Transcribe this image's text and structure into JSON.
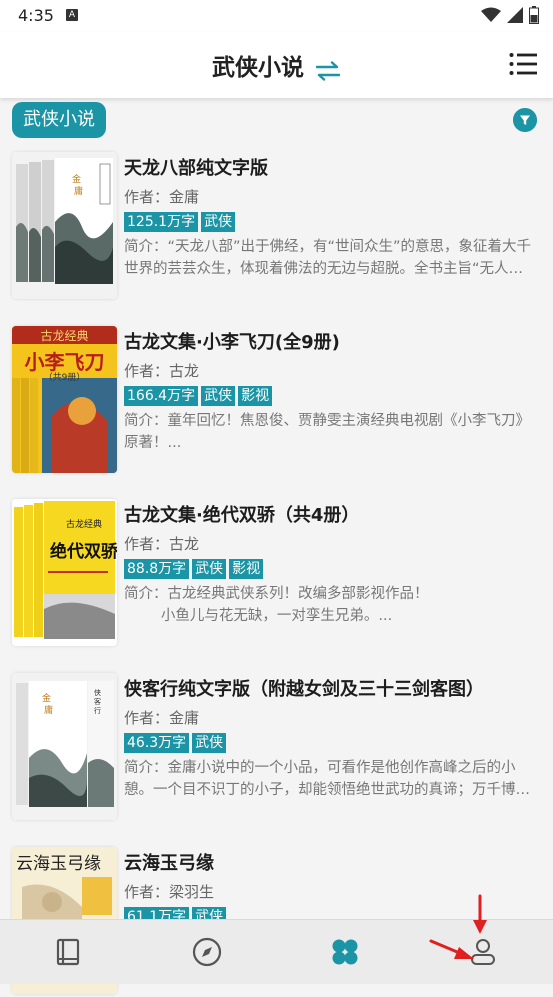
{
  "status": {
    "time": "4:35",
    "notif_letter": "A"
  },
  "header": {
    "title": "武侠小说",
    "swap_icon": "swap-arrows-icon",
    "menu_icon": "list-menu-icon"
  },
  "category_chip": "武侠小说",
  "filter_icon": "filter-icon",
  "colors": {
    "accent": "#1b95a6",
    "arrow": "#e02020"
  },
  "books": [
    {
      "title": "天龙八部纯文字版",
      "author": "作者：金庸",
      "tags": [
        "125.1万字",
        "武侠"
      ],
      "intro": "简介：“天龙八部”出于佛经，有“世间众生”的意思，象征着大千世界的芸芸众生，体现着佛法的无边与超脱。全书主旨“无人…"
    },
    {
      "title": "古龙文集·小李飞刀(全9册)",
      "author": "作者：古龙",
      "tags": [
        "166.4万字",
        "武侠",
        "影视"
      ],
      "intro": "简介：童年回忆！焦恩俊、贾静雯主演经典电视剧《小李飞刀》原著！...",
      "cover_text": {
        "top": "古龙经典",
        "main": "小李飞刀",
        "sub": "（共9册）"
      }
    },
    {
      "title": "古龙文集·绝代双骄（共4册）",
      "author": "作者：古龙",
      "tags": [
        "88.8万字",
        "武侠",
        "影视"
      ],
      "intro": "简介：古龙经典武侠系列！改编多部影视作品！\n        小鱼儿与花无缺，一对孪生兄弟。..."
    },
    {
      "title": "侠客行纯文字版（附越女剑及三十三剑客图）",
      "author": "作者：金庸",
      "tags": [
        "46.3万字",
        "武侠"
      ],
      "intro": "简介：金庸小说中的一个小品，可看作是他创作高峰之后的小憩。一个目不识丁的小子，却能领悟绝世武功的真谛；万千博…"
    },
    {
      "title": "云海玉弓缘",
      "author": "作者：梁羽生",
      "tags": [
        "61.1万字",
        "武侠"
      ],
      "intro": ""
    }
  ],
  "bottom_nav": [
    {
      "id": "bookshelf",
      "icon": "book-icon",
      "active": false
    },
    {
      "id": "discover",
      "icon": "compass-icon",
      "active": false
    },
    {
      "id": "store",
      "icon": "clover-grid-icon",
      "active": true
    },
    {
      "id": "profile",
      "icon": "person-icon",
      "active": false
    }
  ]
}
